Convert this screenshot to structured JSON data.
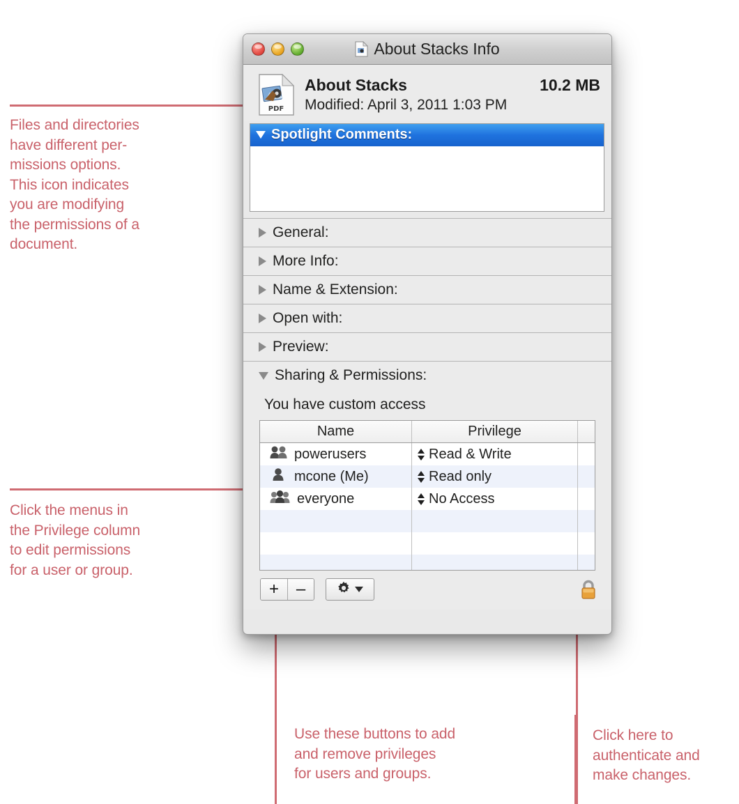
{
  "window": {
    "title": "About Stacks Info",
    "title_icon": "document-info-icon",
    "traffic_lights": [
      "close-button",
      "minimize-button",
      "zoom-button"
    ],
    "header": {
      "icon": "pdf-document-icon",
      "file_name": "About Stacks",
      "file_size": "10.2 MB",
      "modified": "Modified: April 3, 2011 1:03 PM"
    },
    "spotlight": {
      "label": "Spotlight Comments:",
      "value": "",
      "expanded": true
    },
    "sections": [
      {
        "label": "General:",
        "expanded": false
      },
      {
        "label": "More Info:",
        "expanded": false
      },
      {
        "label": "Name & Extension:",
        "expanded": false
      },
      {
        "label": "Open with:",
        "expanded": false
      },
      {
        "label": "Preview:",
        "expanded": false
      },
      {
        "label": "Sharing & Permissions:",
        "expanded": true
      }
    ],
    "permissions": {
      "access_summary": "You have custom access",
      "columns": [
        "Name",
        "Privilege"
      ],
      "rows": [
        {
          "icon": "group-icon",
          "name": "powerusers",
          "privilege": "Read & Write"
        },
        {
          "icon": "person-icon",
          "name": "mcone (Me)",
          "privilege": "Read only"
        },
        {
          "icon": "everyone-icon",
          "name": "everyone",
          "privilege": "No Access"
        }
      ],
      "toolbar": {
        "add_label": "+",
        "remove_label": "–",
        "gear_label": "action-gear",
        "lock_label": "locked"
      }
    }
  },
  "annotations": {
    "icon_note": "Files and directories\nhave different per-\nmissions options.\nThis icon indicates\nyou are modifying\nthe permissions of a\ndocument.",
    "privilege_note": "Click the menus in\nthe Privilege column\nto edit permissions\nfor a user or group.",
    "buttons_note": "Use these buttons to add\nand remove privileges\nfor users and groups.",
    "lock_note": "Click here to\nauthenticate and\nmake changes.",
    "accent_color": "#cf6b72"
  }
}
